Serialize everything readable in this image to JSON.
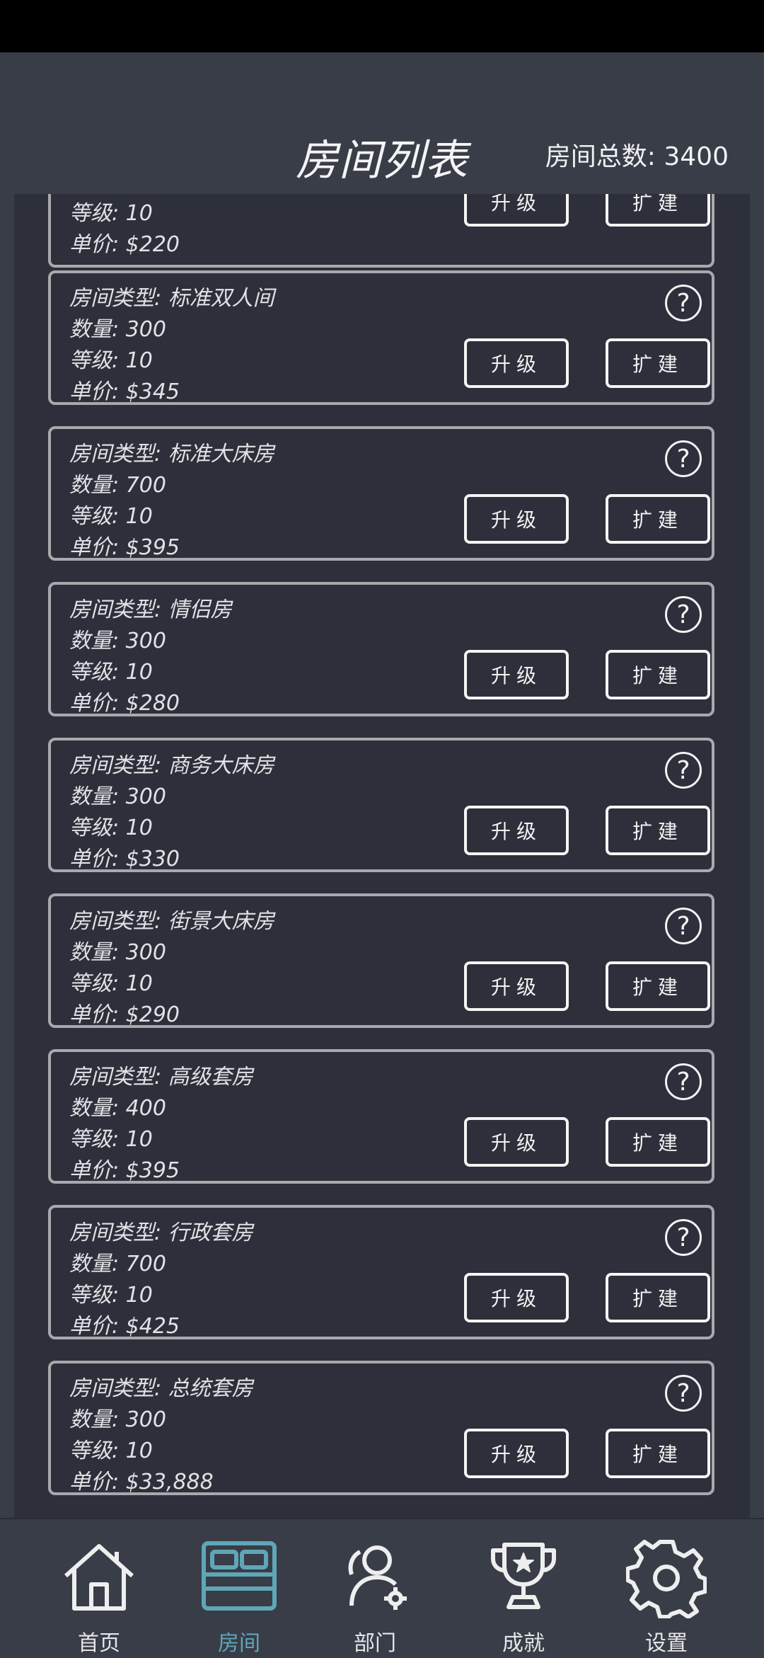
{
  "header": {
    "title": "房间列表",
    "total": "房间总数: 3400"
  },
  "rooms": [
    {
      "type": "",
      "count": "等级: 10",
      "level": "",
      "price": "单价: $220"
    },
    {
      "type": "房间类型: 标准双人间",
      "count": "数量: 300",
      "level": "等级: 10",
      "price": "单价: $345"
    },
    {
      "type": "房间类型: 标准大床房",
      "count": "数量: 700",
      "level": "等级: 10",
      "price": "单价: $395"
    },
    {
      "type": "房间类型: 情侣房",
      "count": "数量: 300",
      "level": "等级: 10",
      "price": "单价: $280"
    },
    {
      "type": "房间类型: 商务大床房",
      "count": "数量: 300",
      "level": "等级: 10",
      "price": "单价: $330"
    },
    {
      "type": "房间类型: 街景大床房",
      "count": "数量: 300",
      "level": "等级: 10",
      "price": "单价: $290"
    },
    {
      "type": "房间类型: 高级套房",
      "count": "数量: 400",
      "level": "等级: 10",
      "price": "单价: $395"
    },
    {
      "type": "房间类型: 行政套房",
      "count": "数量: 700",
      "level": "等级: 10",
      "price": "单价: $425"
    },
    {
      "type": "房间类型: 总统套房",
      "count": "数量: 300",
      "level": "等级: 10",
      "price": "单价: $33,888"
    }
  ],
  "buttons": {
    "upgrade": "升级",
    "expand": "扩建",
    "help": "?"
  },
  "nav": [
    {
      "label": "首页",
      "icon": "home-icon"
    },
    {
      "label": "房间",
      "icon": "bed-icon",
      "active": true
    },
    {
      "label": "部门",
      "icon": "department-icon"
    },
    {
      "label": "成就",
      "icon": "trophy-icon"
    },
    {
      "label": "设置",
      "icon": "gear-icon"
    }
  ],
  "colors": {
    "accent": "#5fa6b8",
    "background": "#2d2f3a",
    "header": "#383d47"
  }
}
